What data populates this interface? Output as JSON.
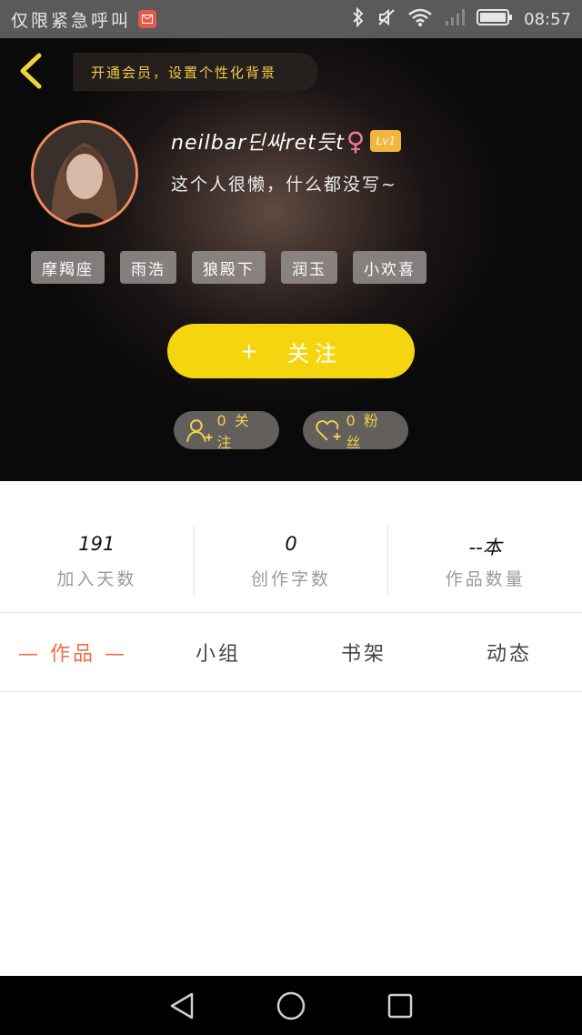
{
  "status_bar": {
    "carrier_text": "仅限紧急呼叫",
    "time": "08:57",
    "icons": [
      "mail-icon",
      "bluetooth-icon",
      "mute-icon",
      "wifi-icon",
      "signal-icon",
      "battery-icon"
    ]
  },
  "header": {
    "vip_prompt": "开通会员，设置个性化背景"
  },
  "profile": {
    "username": "neilbar딘싸ret듯t",
    "gender_symbol": "♀",
    "level": "Lv1",
    "bio": "这个人很懒，什么都没写~",
    "tags": [
      "摩羯座",
      "雨浩",
      "狼殿下",
      "润玉",
      "小欢喜"
    ]
  },
  "actions": {
    "follow_plus": "+",
    "follow_label": "关注",
    "following_text": "0 关注",
    "fans_text": "0 粉丝"
  },
  "counters": [
    {
      "value": "191",
      "label": "加入天数"
    },
    {
      "value": "0",
      "label": "创作字数"
    },
    {
      "value": "--本",
      "label": "作品数量"
    }
  ],
  "tabs": [
    {
      "label": "— 作品 —",
      "active": true
    },
    {
      "label": "小组",
      "active": false
    },
    {
      "label": "书架",
      "active": false
    },
    {
      "label": "动态",
      "active": false
    }
  ],
  "colors": {
    "accent_yellow": "#f5d50f",
    "tab_active": "#ef6f3e",
    "vip_text": "#f4c948",
    "avatar_ring": "#ef8a5c",
    "level_badge": "#f3b53b"
  }
}
